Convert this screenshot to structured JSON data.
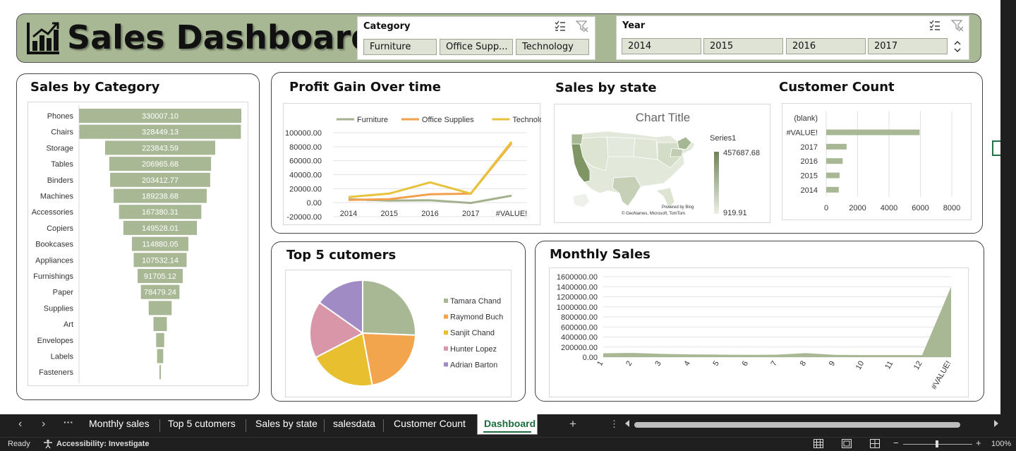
{
  "header": {
    "title": "Sales Dashboard",
    "category_slicer": {
      "title": "Category",
      "items": [
        "Furniture",
        "Office Supp...",
        "Technology"
      ]
    },
    "year_slicer": {
      "title": "Year",
      "items": [
        "2014",
        "2015",
        "2016",
        "2017"
      ]
    }
  },
  "sales_by_category": {
    "title": "Sales by Category",
    "chart_data": {
      "type": "bar",
      "categories": [
        "Phones",
        "Chairs",
        "Storage",
        "Tables",
        "Binders",
        "Machines",
        "Accessories",
        "Copiers",
        "Bookcases",
        "Appliances",
        "Furnishings",
        "Paper",
        "Supplies",
        "Art",
        "Envelopes",
        "Labels",
        "Fasteners"
      ],
      "values": [
        330007.1,
        328449.13,
        223843.59,
        206965.68,
        203412.77,
        189238.68,
        167380.31,
        149528.01,
        114880.05,
        107532.14,
        91705.12,
        78479.24,
        46673.54,
        27118.79,
        16476.4,
        12486.31,
        3024.28
      ],
      "labels": [
        "330007.10",
        "328449.13",
        "223843.59",
        "206965.68",
        "203412.77",
        "189238.68",
        "167380.31",
        "149528.01",
        "114880.05",
        "107532.14",
        "91705.12",
        "78479.24",
        "",
        "",
        "",
        "",
        ""
      ],
      "style": "funnel",
      "color": "#a9b894"
    }
  },
  "profit_gain": {
    "title": "Profit Gain Over time",
    "chart_data": {
      "type": "line",
      "categories": [
        "2014",
        "2015",
        "2016",
        "2017",
        "#VALUE!"
      ],
      "series": [
        {
          "name": "Furniture",
          "color": "#a3b18e",
          "values": [
            5000,
            3000,
            3500,
            -500,
            10000
          ]
        },
        {
          "name": "Office Supplies",
          "color": "#f2a04c",
          "values": [
            4000,
            5000,
            12000,
            13000,
            85000
          ]
        },
        {
          "name": "Technology",
          "color": "#e8c23a",
          "values": [
            8000,
            13000,
            29000,
            13000,
            87000
          ]
        }
      ],
      "yticks": [
        "100000.00",
        "80000.00",
        "60000.00",
        "40000.00",
        "20000.00",
        "0.00",
        "-20000.00"
      ],
      "ylim": [
        -20000,
        100000
      ],
      "legend": "top"
    }
  },
  "sales_by_state": {
    "title": "Sales by state",
    "chart_title": "Chart Title",
    "legend_title": "Series1",
    "max_label": "457687.68",
    "min_label": "919.91",
    "powered": "Powered by Bing",
    "credits": "© GeoNames, Microsoft, TomTom"
  },
  "customer_count": {
    "title": "Customer Count",
    "chart_data": {
      "type": "bar",
      "categories": [
        "(blank)",
        "#VALUE!",
        "2017",
        "2016",
        "2015",
        "2014"
      ],
      "values": [
        0,
        5950,
        1300,
        1050,
        850,
        800
      ],
      "xticks": [
        "0",
        "2000",
        "4000",
        "6000",
        "8000"
      ],
      "xlim": [
        0,
        8000
      ],
      "orientation": "horizontal"
    }
  },
  "top5": {
    "title": "Top 5 cutomers",
    "chart_data": {
      "type": "pie",
      "labels": [
        "Tamara Chand",
        "Raymond Buch",
        "Sanjit Chand",
        "Hunter Lopez",
        "Adrian Barton"
      ],
      "values": [
        25.6,
        21.5,
        20.3,
        17.4,
        15.2
      ],
      "colors": [
        "#a9b894",
        "#f2a54c",
        "#e8c02f",
        "#d896a8",
        "#a18bc5"
      ],
      "legend": "right"
    }
  },
  "monthly_sales": {
    "title": "Monthly Sales",
    "chart_data": {
      "type": "area",
      "categories": [
        "1",
        "2",
        "3",
        "4",
        "5",
        "6",
        "7",
        "8",
        "9",
        "10",
        "11",
        "12",
        "#VALUE!"
      ],
      "values": [
        75000,
        85000,
        65000,
        55000,
        50000,
        45000,
        50000,
        80000,
        45000,
        40000,
        40000,
        40000,
        1400000
      ],
      "yticks": [
        "1600000.00",
        "1400000.00",
        "1200000.00",
        "1000000.00",
        "800000.00",
        "600000.00",
        "400000.00",
        "200000.00",
        "0.00"
      ],
      "ylim": [
        0,
        1600000
      ],
      "color": "#a9b894"
    }
  },
  "tabs": [
    "Monthly sales",
    "Top 5 cutomers",
    "Sales by state",
    "salesdata",
    "Customer Count",
    "Dashboard"
  ],
  "active_tab": "Dashboard",
  "status": {
    "ready": "Ready",
    "accessibility": "Accessibility: Investigate",
    "zoom": "100%"
  },
  "colors": {
    "accent": "#a9b894",
    "header_bg": "#a9b894",
    "tabbar": "#1f1f1f"
  }
}
